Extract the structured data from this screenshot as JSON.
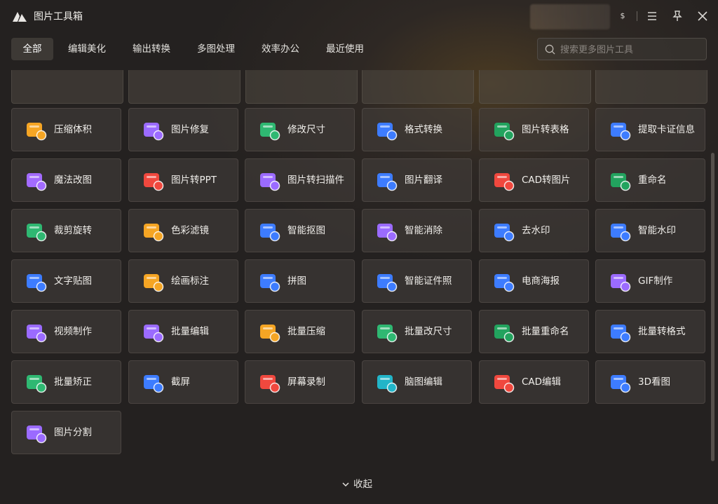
{
  "app": {
    "title": "图片工具箱"
  },
  "titlebar": {
    "user_badge": "$"
  },
  "tabs": [
    "全部",
    "编辑美化",
    "输出转换",
    "多图处理",
    "效率办公",
    "最近使用"
  ],
  "search": {
    "placeholder": "搜索更多图片工具"
  },
  "tools": [
    {
      "label": "压缩体积",
      "icon": "compress-icon",
      "color": "#f5a524"
    },
    {
      "label": "图片修复",
      "icon": "hd-repair-icon",
      "color": "#9b6bff"
    },
    {
      "label": "修改尺寸",
      "icon": "resize-icon",
      "color": "#2fb872"
    },
    {
      "label": "格式转换",
      "icon": "format-convert-icon",
      "color": "#3d7cff"
    },
    {
      "label": "图片转表格",
      "icon": "image-to-excel-icon",
      "color": "#22a35e"
    },
    {
      "label": "提取卡证信息",
      "icon": "id-card-icon",
      "color": "#3d7cff"
    },
    {
      "label": "魔法改图",
      "icon": "magic-edit-icon",
      "color": "#a36bff"
    },
    {
      "label": "图片转PPT",
      "icon": "image-to-ppt-icon",
      "color": "#f0483e"
    },
    {
      "label": "图片转扫描件",
      "icon": "scan-icon",
      "color": "#9b6bff"
    },
    {
      "label": "图片翻译",
      "icon": "translate-icon",
      "color": "#3d7cff"
    },
    {
      "label": "CAD转图片",
      "icon": "cad-to-image-icon",
      "color": "#f0483e"
    },
    {
      "label": "重命名",
      "icon": "rename-icon",
      "color": "#22a35e"
    },
    {
      "label": "裁剪旋转",
      "icon": "crop-rotate-icon",
      "color": "#2fb872"
    },
    {
      "label": "色彩滤镜",
      "icon": "color-filter-icon",
      "color": "#f5a524"
    },
    {
      "label": "智能抠图",
      "icon": "smart-cutout-icon",
      "color": "#3d7cff"
    },
    {
      "label": "智能消除",
      "icon": "eraser-icon",
      "color": "#9b6bff"
    },
    {
      "label": "去水印",
      "icon": "remove-watermark-icon",
      "color": "#3d7cff"
    },
    {
      "label": "智能水印",
      "icon": "add-watermark-icon",
      "color": "#3d7cff"
    },
    {
      "label": "文字贴图",
      "icon": "text-sticker-icon",
      "color": "#3d7cff"
    },
    {
      "label": "绘画标注",
      "icon": "draw-annotate-icon",
      "color": "#f5a524"
    },
    {
      "label": "拼图",
      "icon": "collage-icon",
      "color": "#3d7cff"
    },
    {
      "label": "智能证件照",
      "icon": "id-photo-icon",
      "color": "#3d7cff"
    },
    {
      "label": "电商海报",
      "icon": "poster-icon",
      "color": "#3d7cff"
    },
    {
      "label": "GIF制作",
      "icon": "gif-icon",
      "color": "#9b6bff"
    },
    {
      "label": "视频制作",
      "icon": "video-icon",
      "color": "#9b6bff"
    },
    {
      "label": "批量编辑",
      "icon": "batch-edit-icon",
      "color": "#9b6bff"
    },
    {
      "label": "批量压缩",
      "icon": "batch-compress-icon",
      "color": "#f5a524"
    },
    {
      "label": "批量改尺寸",
      "icon": "batch-resize-icon",
      "color": "#2fb872"
    },
    {
      "label": "批量重命名",
      "icon": "batch-rename-icon",
      "color": "#22a35e"
    },
    {
      "label": "批量转格式",
      "icon": "batch-convert-icon",
      "color": "#3d7cff"
    },
    {
      "label": "批量矫正",
      "icon": "batch-correct-icon",
      "color": "#2fb872"
    },
    {
      "label": "截屏",
      "icon": "screenshot-icon",
      "color": "#3d7cff"
    },
    {
      "label": "屏幕录制",
      "icon": "screen-record-icon",
      "color": "#f0483e"
    },
    {
      "label": "脑图编辑",
      "icon": "mindmap-icon",
      "color": "#22b5c8"
    },
    {
      "label": "CAD编辑",
      "icon": "cad-edit-icon",
      "color": "#f0483e"
    },
    {
      "label": "3D看图",
      "icon": "3d-view-icon",
      "color": "#3d7cff"
    },
    {
      "label": "图片分割",
      "icon": "split-icon",
      "color": "#9b6bff"
    }
  ],
  "footer": {
    "collapse_label": "收起"
  }
}
